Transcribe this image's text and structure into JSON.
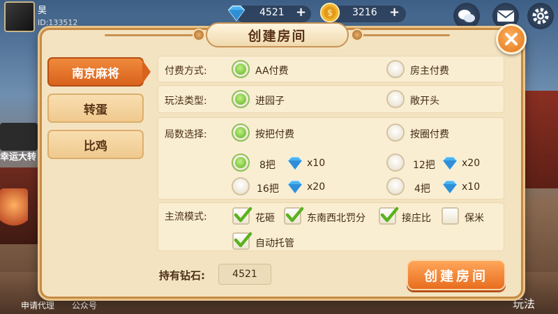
{
  "topbar": {
    "player_name": "昊",
    "player_id": "ID:133512",
    "diamonds": "4521",
    "coins": "3216",
    "plus": "+",
    "icons": [
      "chat-icon",
      "mail-icon",
      "settings-icon"
    ]
  },
  "background": {
    "left_banner": "幸运大转",
    "bottom_labels": [
      "申请代理",
      "公众号",
      "玩法"
    ]
  },
  "dialog": {
    "title": "创建房间",
    "close": "✕",
    "tabs": [
      "南京麻将",
      "转蛋",
      "比鸡"
    ],
    "active_tab": 0,
    "payment": {
      "label": "付费方式:",
      "options": [
        "AA付费",
        "房主付费"
      ],
      "selected": 0
    },
    "play_type": {
      "label": "玩法类型:",
      "options": [
        "进园子",
        "敞开头"
      ],
      "selected": 0
    },
    "rounds": {
      "label": "局数选择:",
      "options": [
        "按把付费",
        "按圈付费"
      ],
      "selected": 0,
      "counts": [
        {
          "label": "8把",
          "cost": "x10",
          "selected": true
        },
        {
          "label": "12把",
          "cost": "x20",
          "selected": false
        },
        {
          "label": "16把",
          "cost": "x20",
          "selected": false
        },
        {
          "label": "4把",
          "cost": "x10",
          "selected": false
        }
      ]
    },
    "mode": {
      "label": "主流模式:",
      "options": [
        {
          "label": "花砸",
          "checked": true
        },
        {
          "label": "东南西北罚分",
          "checked": true
        },
        {
          "label": "接庄比",
          "checked": true
        },
        {
          "label": "保米",
          "checked": false
        },
        {
          "label": "自动托管",
          "checked": true
        }
      ]
    },
    "holding_label": "持有钻石:",
    "holding_value": "4521",
    "create_button": "创建房间"
  },
  "colors": {
    "accent_orange": "#e86d1e",
    "panel": "#f4e3c0",
    "radio_on": "#5ab21f"
  }
}
